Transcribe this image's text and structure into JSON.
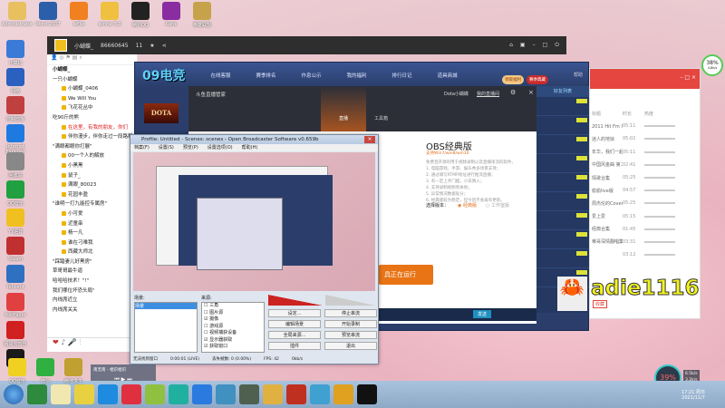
{
  "desktop": {
    "top_icons": [
      {
        "label": "Administrator",
        "color": "#e8c060"
      },
      {
        "label": "Word 2007",
        "color": "#2b5faa"
      },
      {
        "label": "ieFile",
        "color": "#f08020"
      },
      {
        "label": "winrar 5.0",
        "color": "#f0c040"
      },
      {
        "label": "腾讯QQ",
        "color": "#222"
      },
      {
        "label": "Rank",
        "color": "#8a2da0"
      },
      {
        "label": "英雄联盟",
        "color": "#c6a24a"
      }
    ],
    "left_icons": [
      {
        "label": "计算机",
        "color": "#3c7ad8"
      },
      {
        "label": "网络",
        "color": "#2a60c0"
      },
      {
        "label": "控制面板",
        "color": "#c04040"
      },
      {
        "label": "Internet Explorer",
        "color": "#1e7ae0"
      },
      {
        "label": "回收站",
        "color": "#888"
      },
      {
        "label": "QQ音乐",
        "color": "#20a040"
      },
      {
        "label": "YY语音",
        "color": "#f0c020"
      },
      {
        "label": "Steam",
        "color": "#c03030"
      },
      {
        "label": "Tencent",
        "color": "#3070c0"
      },
      {
        "label": "PotPlayer",
        "color": "#e04040"
      },
      {
        "label": "网易云音乐",
        "color": "#d02020"
      },
      {
        "label": "QQ",
        "color": "#1a1a1a"
      }
    ],
    "bottom_icons": [
      {
        "label": "QQ音乐",
        "color": "#f0d020"
      },
      {
        "label": "微信",
        "color": "#30b040"
      },
      {
        "label": "绝地求生",
        "color": "#c0a030"
      }
    ]
  },
  "yy": {
    "title": "小蝴蝶_",
    "channel_id": "86660645",
    "online": "11",
    "top": "小蝴蝶_",
    "list": [
      {
        "t": "一只小蝴蝶",
        "sub": false
      },
      {
        "t": "小蝴蝶_0406",
        "sub": true
      },
      {
        "t": "We Will You",
        "sub": true
      },
      {
        "t": "飞花花丛中",
        "sub": true
      },
      {
        "t": "吃90斤的熊",
        "sub": false
      },
      {
        "t": "在这里，有我的朋友，你们",
        "sub": true,
        "red": true
      },
      {
        "t": "伴你漫步，伴你走过一段路程",
        "sub": true
      },
      {
        "t": "\"满眼都眼你打展\"",
        "sub": false
      },
      {
        "t": "00一个人的解放",
        "sub": true
      },
      {
        "t": "小黑黑",
        "sub": true
      },
      {
        "t": "鼠子_",
        "sub": true
      },
      {
        "t": "满眼_80023",
        "sub": true
      },
      {
        "t": "花园丰盈",
        "sub": true
      },
      {
        "t": "\"谁明一打九能控专属房\"",
        "sub": false
      },
      {
        "t": "小可爱",
        "sub": true
      },
      {
        "t": "近童串",
        "sub": true
      },
      {
        "t": "杨一凡",
        "sub": true
      },
      {
        "t": "谁在刁难我",
        "sub": true
      },
      {
        "t": "西藏大师北",
        "sub": true
      },
      {
        "t": "\"踩踏妻儿好黑房\"",
        "sub": false
      },
      {
        "t": "草哥哥最牛逼",
        "sub": false
      },
      {
        "t": "哈哈哈技术！\"!\"",
        "sub": false
      },
      {
        "t": "我们哪位坏恐头局\"",
        "sub": false
      },
      {
        "t": "内线席近立",
        "sub": false
      },
      {
        "t": "内线席关关",
        "sub": false
      }
    ]
  },
  "w09": {
    "logo": "09电竞",
    "nav": [
      "在线客服",
      "赛季排名",
      "作息公示",
      "我的福利",
      "排行日记",
      "道具商城"
    ],
    "btn1": "领取福利",
    "btn2": "赛季典藏",
    "help": "帮助",
    "friend_tab": "好友列表",
    "game": "DOTA"
  },
  "douyu": {
    "title": "斗鱼直播管家",
    "user": "Dota小蝴蝶",
    "my_room": "我的直播间",
    "tab_live": "直播",
    "tab_tools": "工具箱",
    "obs_title": "OBS经典版",
    "obs_support": "支持Win7/win8/win10",
    "desc": "免费且开源的用于视频录制以及直播串流的软件。",
    "features": [
      "1. 电脑游戏、手游、娱乐秀多场景支持；",
      "2. 通过填写RTMP地址进行推流直播；",
      "3. 有一定上手门槛，小白慎入；",
      "4. 支持录制视频到本地；",
      "5. 异常情况数据处分；",
      "6. 经典版较为稳定，但今后不会再有更新。"
    ],
    "version_label": "选择版本：",
    "opt1": "经典版",
    "opt2": "工作室版",
    "hint": "将从OBS官方经典启动",
    "run_btn": "具正在运行",
    "send": "发送"
  },
  "obs": {
    "title": "Profile: Untitled - Scenes: scenes - Open Broadcaster Software v0.659b",
    "menu": [
      "档案(F)",
      "设置(S)",
      "预览(P)",
      "设置选项(O)",
      "帮助(H)"
    ],
    "scenes_label": "场景:",
    "scene": "场景",
    "sources_label": "来源:",
    "sources": [
      {
        "n": "三角",
        "c": false
      },
      {
        "n": "图片源",
        "c": false
      },
      {
        "n": "摄像",
        "c": true
      },
      {
        "n": "游戏源",
        "c": false
      },
      {
        "n": "视频捕获设备",
        "c": false
      },
      {
        "n": "显示器获取",
        "c": true
      },
      {
        "n": "获取窗口",
        "c": true
      }
    ],
    "buttons": [
      "设定...",
      "停止串流",
      "编辑场景",
      "开始录制",
      "全局来源...",
      "预览串流",
      "插件",
      "退出"
    ],
    "status": {
      "window": "无法找到窗口",
      "time": "0:00:01 (LIVE)",
      "dropped": "丢失帧数: 0 (0.00%)",
      "fps": "FPS: 42",
      "rate": "0kb/s"
    }
  },
  "music": {
    "col_title": "标题",
    "col_dur": "时长",
    "col_hot": "热度",
    "rows": [
      [
        "2011 Hit Fm 年度",
        "05:11"
      ],
      [
        "迷人的地狱",
        "05:02"
      ],
      [
        "年华，我们一起",
        "05:11"
      ],
      [
        "中国风金曲 第二期",
        "02:41"
      ],
      [
        "情歌合集",
        "05:25"
      ],
      [
        "偷偷live版",
        "04:57"
      ],
      [
        "周杰伦的Cover集",
        "05:25"
      ],
      [
        "爱上爱",
        "05:15"
      ],
      [
        "经典合集",
        "01:45"
      ],
      [
        "难哥深情翻唱集",
        "03:31"
      ],
      [
        "",
        "03:12"
      ]
    ],
    "fav": "收藏"
  },
  "overlay": {
    "name": "adie1116",
    "net_top": "38%",
    "net_top_sub": "4.8k/s",
    "net_bottom": "39%",
    "up": "6.5k/s",
    "down": "3.2k/s"
  },
  "player_popup": {
    "title": "南无南 - 相识相识"
  },
  "taskbar": {
    "time": "17:21 周日",
    "date": "2021/11/7",
    "apps": [
      "#2e8a3c",
      "#f0e8b0",
      "#e8d040",
      "#1e8ae0",
      "#e03040",
      "#90c040",
      "#20b0a0",
      "#2a7ae0",
      "#4090c0",
      "#506050",
      "#e0b040",
      "#c03020",
      "#40a0d0",
      "#e0a020",
      "#111"
    ]
  }
}
